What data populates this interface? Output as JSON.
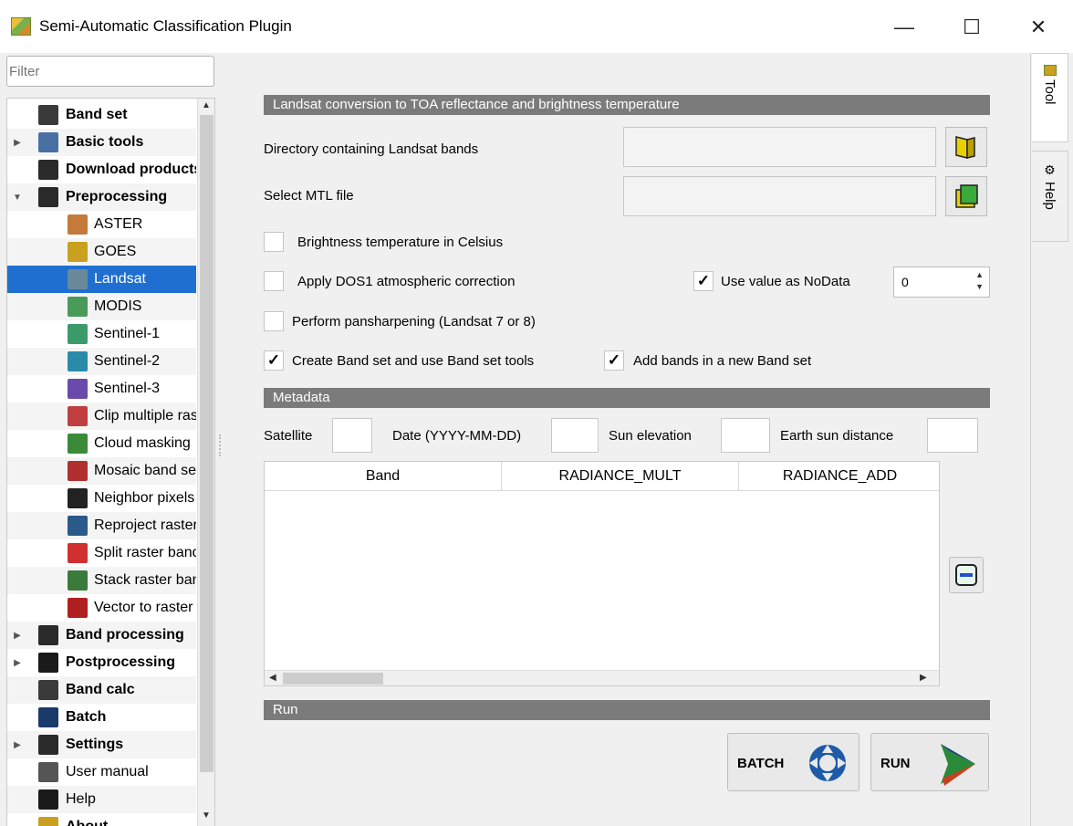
{
  "window": {
    "title": "Semi-Automatic Classification Plugin",
    "minimize": "—",
    "maximize": "☐",
    "close": "✕"
  },
  "filter": {
    "placeholder": "Filter"
  },
  "tree": [
    {
      "label": "Band set",
      "bold": true,
      "icon": "band-set-icon",
      "color": "#3a3a3a"
    },
    {
      "label": "Basic tools",
      "bold": true,
      "icon": "basic-tools-icon",
      "color": "#4a6fa5",
      "arrow": "▶"
    },
    {
      "label": "Download products",
      "bold": true,
      "icon": "download-icon",
      "color": "#2a2a2a"
    },
    {
      "label": "Preprocessing",
      "bold": true,
      "icon": "preprocessing-icon",
      "color": "#2a2a2a",
      "arrow": "▼"
    },
    {
      "label": "ASTER",
      "icon": "aster-icon",
      "color": "#c47a3a",
      "child": true
    },
    {
      "label": "GOES",
      "icon": "goes-icon",
      "color": "#c9a020",
      "child": true
    },
    {
      "label": "Landsat",
      "icon": "landsat-icon",
      "color": "#6a8a9a",
      "child": true,
      "selected": true
    },
    {
      "label": "MODIS",
      "icon": "modis-icon",
      "color": "#4a9a5a",
      "child": true
    },
    {
      "label": "Sentinel-1",
      "icon": "sentinel-1-icon",
      "color": "#3a9a6a",
      "child": true
    },
    {
      "label": "Sentinel-2",
      "icon": "sentinel-2-icon",
      "color": "#2a8aaa",
      "child": true
    },
    {
      "label": "Sentinel-3",
      "icon": "sentinel-3-icon",
      "color": "#6a4aaa",
      "child": true
    },
    {
      "label": "Clip multiple rasters",
      "icon": "clip-icon",
      "color": "#c04040",
      "child": true
    },
    {
      "label": "Cloud masking",
      "icon": "cloud-mask-icon",
      "color": "#3a8a3a",
      "child": true
    },
    {
      "label": "Mosaic band sets",
      "icon": "mosaic-icon",
      "color": "#b03030",
      "child": true
    },
    {
      "label": "Neighbor pixels",
      "icon": "neighbor-icon",
      "color": "#222222",
      "child": true
    },
    {
      "label": "Reproject raster bands",
      "icon": "reproject-icon",
      "color": "#2a5a8a",
      "child": true
    },
    {
      "label": "Split raster bands",
      "icon": "split-icon",
      "color": "#d03030",
      "child": true
    },
    {
      "label": "Stack raster bands",
      "icon": "stack-icon",
      "color": "#3a7a3a",
      "child": true
    },
    {
      "label": "Vector to raster",
      "icon": "vector-raster-icon",
      "color": "#b02020",
      "child": true
    },
    {
      "label": "Band processing",
      "bold": true,
      "icon": "band-processing-icon",
      "color": "#2a2a2a",
      "arrow": "▶"
    },
    {
      "label": "Postprocessing",
      "bold": true,
      "icon": "postprocessing-icon",
      "color": "#1a1a1a",
      "arrow": "▶"
    },
    {
      "label": "Band calc",
      "bold": true,
      "icon": "band-calc-icon",
      "color": "#3a3a3a"
    },
    {
      "label": "Batch",
      "bold": true,
      "icon": "batch-icon",
      "color": "#1a3a6a"
    },
    {
      "label": "Settings",
      "bold": true,
      "icon": "settings-icon",
      "color": "#2a2a2a",
      "arrow": "▶"
    },
    {
      "label": "User manual",
      "icon": "user-manual-icon",
      "color": "#555555"
    },
    {
      "label": "Help",
      "icon": "help-icon",
      "color": "#1a1a1a"
    },
    {
      "label": "About",
      "bold": true,
      "icon": "about-icon",
      "color": "#c9a020"
    }
  ],
  "conversion": {
    "header": "Landsat conversion to TOA reflectance and brightness temperature",
    "dir_label": "Directory containing Landsat bands",
    "mtl_label": "Select MTL file",
    "brightness_celsius": "Brightness temperature in Celsius",
    "dos1": "Apply DOS1 atmospheric correction",
    "nodata_label": "Use value as NoData",
    "nodata_value": "0",
    "pansharpen": "Perform pansharpening (Landsat 7 or 8)",
    "create_bandset": "Create Band set and use Band set tools",
    "add_bands": "Add bands in a new Band set"
  },
  "metadata": {
    "header": "Metadata",
    "satellite": "Satellite",
    "date": "Date (YYYY-MM-DD)",
    "sun_elevation": "Sun elevation",
    "earth_sun_distance": "Earth sun distance",
    "columns": [
      "Band",
      "RADIANCE_MULT",
      "RADIANCE_ADD"
    ]
  },
  "run": {
    "header": "Run",
    "batch_label": "BATCH",
    "run_label": "RUN"
  },
  "side_tabs": {
    "tool": "Tool",
    "help": "Help"
  },
  "colors": {
    "selection": "#1e6fd0",
    "section_bar": "#7b7b7b"
  }
}
